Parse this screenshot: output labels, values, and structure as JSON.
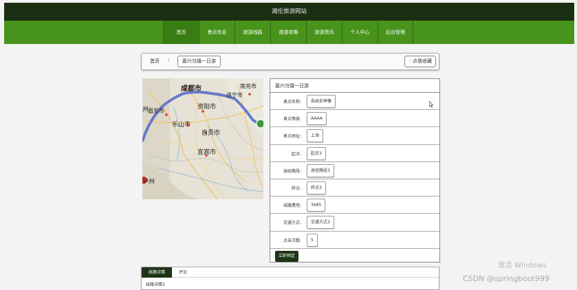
{
  "header": {
    "site_title": "湘伦旅游网站"
  },
  "nav": {
    "items": [
      {
        "label": "首页"
      },
      {
        "label": "景点信息"
      },
      {
        "label": "旅游线路"
      },
      {
        "label": "旅游攻略"
      },
      {
        "label": "旅游资讯"
      },
      {
        "label": "个人中心"
      },
      {
        "label": "后台管理"
      }
    ]
  },
  "breadcrumb": {
    "home": "首页",
    "separator": "/",
    "current": "嘉兴乌镇一日游"
  },
  "favorite": {
    "icon": "star-icon",
    "label": "点我收藏"
  },
  "map": {
    "labels": {
      "nanchong": "南充市",
      "chengdu": "成都市",
      "suining": "遂宁市",
      "zhou": "州",
      "meishan": "眉安市",
      "ziyang": "资阳市",
      "leshan": "乐山市",
      "zigong": "自贡市",
      "yibin": "宜宾市",
      "luzhou": "泸州"
    }
  },
  "details": {
    "title": "嘉兴乌镇一日游",
    "rows": [
      {
        "label": "景点名称:",
        "value": "自由女神像"
      },
      {
        "label": "景点等级:",
        "value": "AAAA"
      },
      {
        "label": "景点地址:",
        "value": "上海"
      },
      {
        "label": "起点:",
        "value": "起点3"
      },
      {
        "label": "途经路段:",
        "value": "途径路段3"
      },
      {
        "label": "终点:",
        "value": "终点3"
      },
      {
        "label": "线路费用:",
        "value": "3685"
      },
      {
        "label": "交通方式:",
        "value": "交通方式3"
      },
      {
        "label": "点击次数:",
        "value": "5"
      }
    ],
    "book_label": "立即预定"
  },
  "tabs": {
    "items": [
      {
        "label": "线路详情"
      },
      {
        "label": "评论"
      }
    ],
    "content": "线路详情3"
  },
  "watermarks": {
    "windows": "激活 Windows",
    "csdn": "CSDN @springboot999"
  },
  "colors": {
    "topbar": "#1a2e12",
    "navbar": "#48931b",
    "accent_dark": "#1e3416"
  }
}
